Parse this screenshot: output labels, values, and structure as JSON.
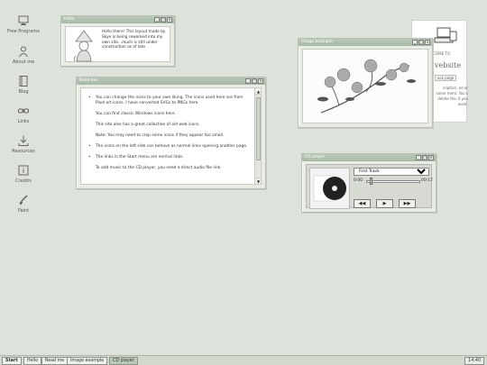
{
  "desktop": {
    "icons": [
      {
        "label": "Free Programs",
        "icon": "monitor-icon"
      },
      {
        "label": "About me",
        "icon": "user-icon"
      },
      {
        "label": "Blog",
        "icon": "notebook-icon"
      },
      {
        "label": "Links",
        "icon": "link-icon"
      },
      {
        "label": "Resources",
        "icon": "download-icon"
      },
      {
        "label": "Credits",
        "icon": "info-icon"
      },
      {
        "label": "Paint",
        "icon": "paint-icon"
      }
    ]
  },
  "windows": {
    "hello": {
      "title": "Hello",
      "text": "Hello there! This layout made by Skye is being reworked into my own site...much is still under construction as of late"
    },
    "readme": {
      "title": "Read me",
      "p1": "You can change the icons to your own liking. The icons used here are from Pixel art icons. I have converted SVGs to PNGs here.",
      "p2": "You can find classic Windows icons here.",
      "p3": "This site also has a great collection of old web icons.",
      "p4": "Note: You may need to crop some icons if they appear too small.",
      "p5": "The icons on the left side can behave as normal links opening another page.",
      "p6": "The links in the Start menu are normal links.",
      "p7": "To add music to the CD player, you need a direct audio file link."
    },
    "image_example": {
      "title": "Image example"
    },
    "cd_player": {
      "title": "CD player",
      "track_selected": "First Track",
      "time_current": "0:00",
      "time_total": "00:17",
      "btn_prev": "◀◀",
      "btn_play": "▶",
      "btn_next": "▶▶"
    }
  },
  "background_page": {
    "welcome": "LCOME TO",
    "title": "vebsite",
    "button": "ack page",
    "text": "cription. ed or some ment. You s delete this it you want."
  },
  "taskbar": {
    "start": "Start",
    "items": [
      "Hello",
      "Read me",
      "Image example",
      "CD player"
    ],
    "active_item": "CD player",
    "clock": "14:40"
  },
  "colors": {
    "desktop_bg": "#dde3da",
    "titlebar": "#a7baa7",
    "active_task": "#b9cab8"
  }
}
